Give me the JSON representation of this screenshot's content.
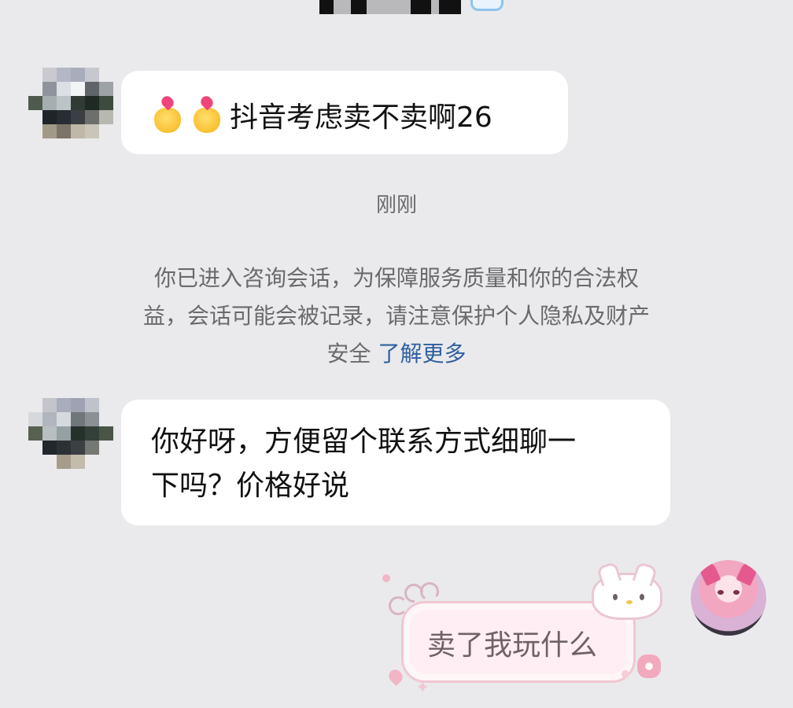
{
  "header": {
    "contact_name": "",
    "verified_icon": "verified-badge-icon"
  },
  "messages": [
    {
      "side": "left",
      "avatar": "blurred-avatar",
      "prefix_icons": [
        "heart-hands-emoji",
        "heart-hands-emoji"
      ],
      "text": "抖音考虑卖不卖啊26"
    },
    {
      "side": "left",
      "avatar": "blurred-avatar",
      "lines": [
        "你好呀，方便留个联系方式细聊一",
        "下吗？价格好说"
      ]
    },
    {
      "side": "right",
      "avatar": "anime-girl-avatar",
      "bubble_style": "hello-kitty-sticker-bubble",
      "text": "卖了我玩什么"
    }
  ],
  "timestamp": "刚刚",
  "notice": {
    "line1": "你已进入咨询会话，为保障服务质量和你的合法权",
    "line2": "益，会话可能会被记录，请注意保护个人隐私及财产",
    "line3_prefix": "安全",
    "link_label": "了解更多"
  },
  "colors": {
    "background": "#eaeaec",
    "bubble": "#ffffff",
    "muted_text": "#6a6a6e",
    "link": "#2e5f9f",
    "pink_accent": "#f2c6d3"
  }
}
